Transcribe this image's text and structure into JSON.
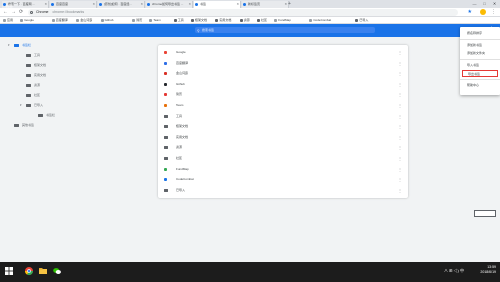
{
  "tabs": [
    {
      "label": "搜索一下 · 百度网 ...",
      "active": false
    },
    {
      "label": "百度百度",
      "active": false
    },
    {
      "label": "[原创]如何 · 百度经...",
      "active": false
    },
    {
      "label": "chrome如何导出书签 ...",
      "active": false
    },
    {
      "label": "书签",
      "active": true
    },
    {
      "label": "新标签页",
      "active": false
    }
  ],
  "new_tab_glyph": "+",
  "window_controls": {
    "minimize": "—",
    "maximize": "□",
    "close": "✕"
  },
  "toolbar": {
    "back": "←",
    "forward": "→",
    "reload": "⟳",
    "site_label": "Chrome",
    "url": "chrome://bookmarks",
    "star": "★",
    "menu": "⋮"
  },
  "bookmarks_bar": [
    {
      "label": "应用",
      "type": "apps"
    },
    {
      "label": "Google",
      "type": "site"
    },
    {
      "label": "百度翻译",
      "type": "site"
    },
    {
      "label": "金山词霸",
      "type": "site"
    },
    {
      "label": "Github",
      "type": "site"
    },
    {
      "label": "简历",
      "type": "site"
    },
    {
      "label": "Team",
      "type": "site"
    },
    {
      "label": "工具",
      "type": "folder"
    },
    {
      "label": "框架文档",
      "type": "folder"
    },
    {
      "label": "实用文档",
      "type": "folder"
    },
    {
      "label": "资源",
      "type": "folder"
    },
    {
      "label": "社区",
      "type": "folder"
    },
    {
      "label": "FundMap",
      "type": "site"
    },
    {
      "label": "CodeCombat",
      "type": "site"
    },
    {
      "label": "已导入",
      "type": "folder"
    }
  ],
  "header": {
    "title": "书签",
    "search_placeholder": "搜索书签",
    "search_icon": "⚲",
    "menu": "⋮"
  },
  "sidebar": [
    {
      "label": "书签栏",
      "depth": 0,
      "selected": true,
      "expandable": true,
      "expanded": true
    },
    {
      "label": "工具",
      "depth": 1,
      "selected": false,
      "expandable": false
    },
    {
      "label": "框架文档",
      "depth": 1,
      "selected": false,
      "expandable": false
    },
    {
      "label": "实用文档",
      "depth": 1,
      "selected": false,
      "expandable": false
    },
    {
      "label": "资源",
      "depth": 1,
      "selected": false,
      "expandable": false
    },
    {
      "label": "社区",
      "depth": 1,
      "selected": false,
      "expandable": false
    },
    {
      "label": "已导入",
      "depth": 1,
      "selected": false,
      "expandable": true,
      "expanded": true
    },
    {
      "label": "书签栏",
      "depth": 2,
      "selected": false,
      "expandable": false
    },
    {
      "label": "其他书签",
      "depth": 0,
      "selected": false,
      "expandable": false
    }
  ],
  "list": [
    {
      "label": "Google",
      "kind": "site",
      "color": "#ea4335"
    },
    {
      "label": "百度翻译",
      "kind": "site",
      "color": "#2e6ee6"
    },
    {
      "label": "金山词霸",
      "kind": "site",
      "color": "#d93025"
    },
    {
      "label": "Github",
      "kind": "site",
      "color": "#24292e"
    },
    {
      "label": "简历",
      "kind": "site",
      "color": "#e53935"
    },
    {
      "label": "Team",
      "kind": "site",
      "color": "#e8710a"
    },
    {
      "label": "工具",
      "kind": "folder",
      "color": "#5f6368"
    },
    {
      "label": "框架文档",
      "kind": "folder",
      "color": "#5f6368"
    },
    {
      "label": "实用文档",
      "kind": "folder",
      "color": "#5f6368"
    },
    {
      "label": "资源",
      "kind": "folder",
      "color": "#5f6368"
    },
    {
      "label": "社区",
      "kind": "folder",
      "color": "#5f6368"
    },
    {
      "label": "FundMap",
      "kind": "site",
      "color": "#34a853"
    },
    {
      "label": "CodeCombat",
      "kind": "site",
      "color": "#1a73e8"
    },
    {
      "label": "已导入",
      "kind": "folder",
      "color": "#5f6368"
    }
  ],
  "row_menu": "⋮",
  "menu": {
    "items": [
      {
        "label": "按名称排序",
        "highlighted": false,
        "separator_after": true
      },
      {
        "label": "添加新书签",
        "highlighted": false,
        "separator_after": false
      },
      {
        "label": "添加新文件夹",
        "highlighted": false,
        "separator_after": true
      },
      {
        "label": "导入书签",
        "highlighted": false,
        "separator_after": false
      },
      {
        "label": "导出书签",
        "highlighted": true,
        "separator_after": true
      },
      {
        "label": "帮助中心",
        "highlighted": false,
        "separator_after": false
      }
    ]
  },
  "colors": {
    "accent": "#1a73e8",
    "highlight_border": "#e53935",
    "taskbar": "#1c1c1c"
  },
  "taskbar": {
    "time": "13:59",
    "date": "2018/6/19",
    "tray": "∧ ⊞ ◁) 中"
  }
}
